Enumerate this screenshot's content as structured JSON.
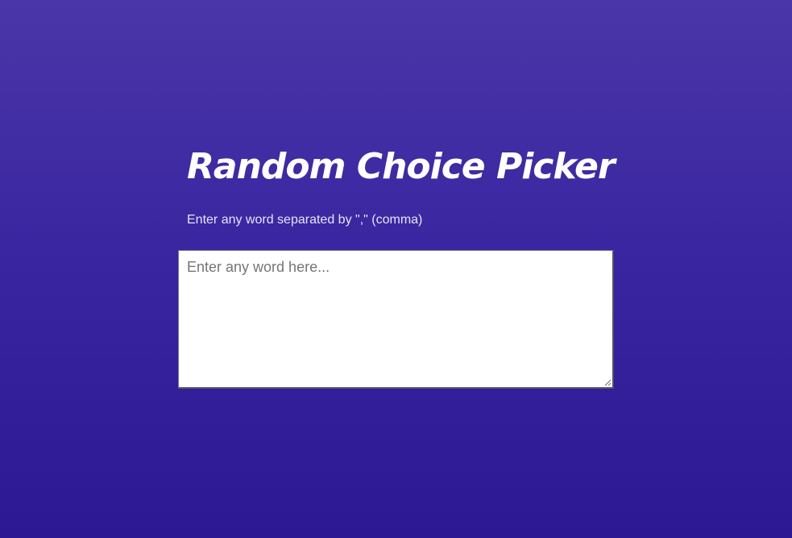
{
  "header": {
    "title": "Random Choice Picker",
    "subtitle": "Enter any word separated by \",\" (comma)"
  },
  "input": {
    "placeholder": "Enter any word here...",
    "value": ""
  },
  "colors": {
    "background_top": "#4b36a8",
    "background_bottom": "#2c1893",
    "title": "#ffffff",
    "textarea_bg": "#ffffff"
  },
  "icons": {
    "resize_handle": "resize-handle-icon"
  }
}
